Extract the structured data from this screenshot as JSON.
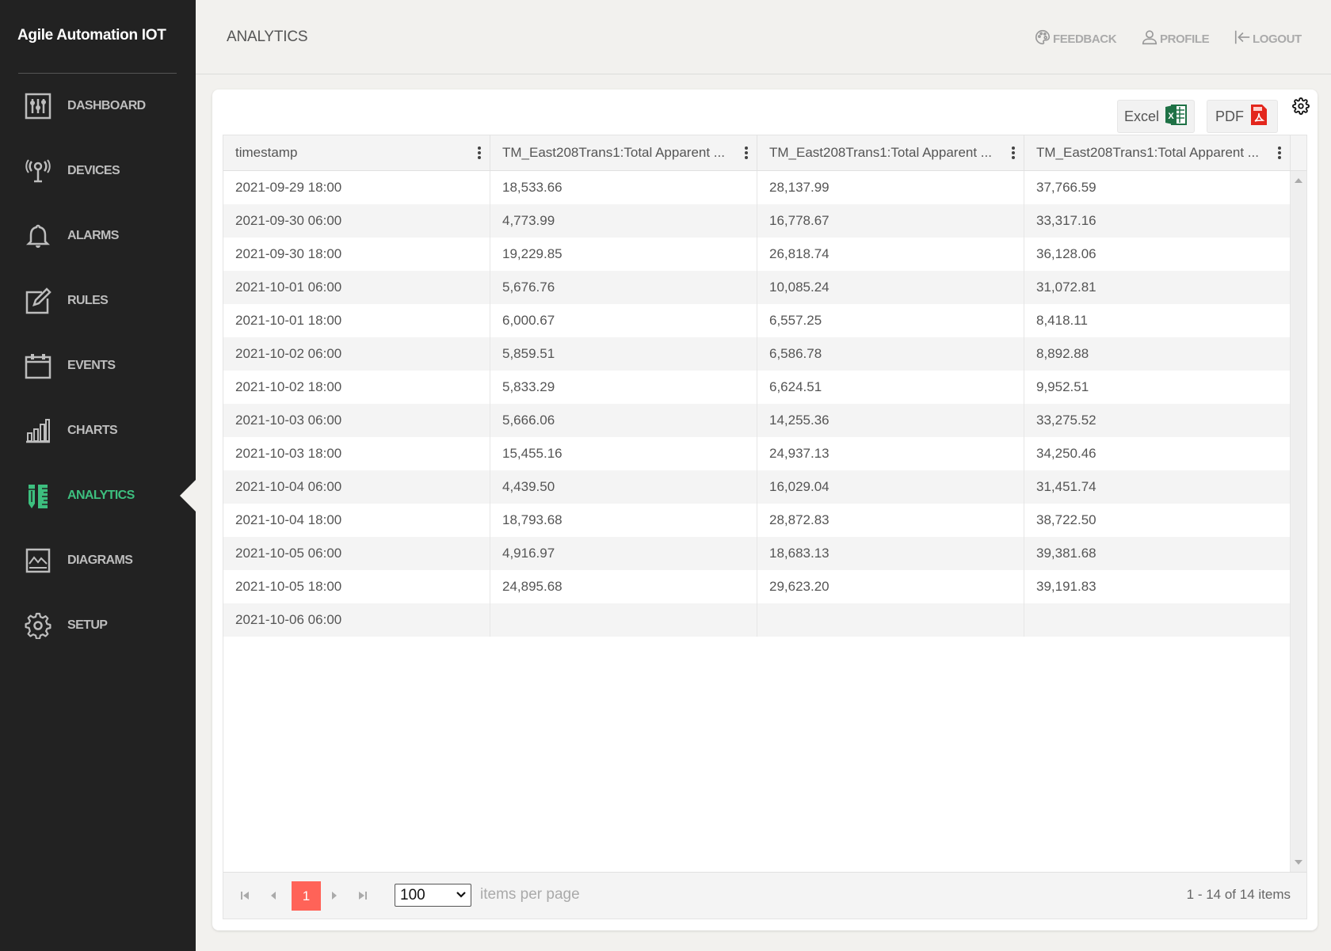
{
  "app": {
    "title": "Agile Automation IOT"
  },
  "sidebar": {
    "items": [
      {
        "label": "DASHBOARD",
        "icon": "dashboard-sliders-icon",
        "active": false
      },
      {
        "label": "DEVICES",
        "icon": "antenna-tower-icon",
        "active": false
      },
      {
        "label": "ALARMS",
        "icon": "bell-icon",
        "active": false
      },
      {
        "label": "RULES",
        "icon": "edit-pencil-icon",
        "active": false
      },
      {
        "label": "EVENTS",
        "icon": "calendar-icon",
        "active": false
      },
      {
        "label": "CHARTS",
        "icon": "bar-chart-icon",
        "active": false
      },
      {
        "label": "ANALYTICS",
        "icon": "pencil-ruler-icon",
        "active": true
      },
      {
        "label": "DIAGRAMS",
        "icon": "image-landscape-icon",
        "active": false
      },
      {
        "label": "SETUP",
        "icon": "gear-icon",
        "active": false
      }
    ],
    "active_color": "#3dbf7f"
  },
  "header": {
    "title": "ANALYTICS",
    "links": {
      "feedback": "FEEDBACK",
      "profile": "PROFILE",
      "logout": "LOGOUT"
    }
  },
  "toolbar": {
    "excel_label": "Excel",
    "pdf_label": "PDF"
  },
  "grid": {
    "columns": [
      "timestamp",
      "TM_East208Trans1:Total Apparent ...",
      "TM_East208Trans1:Total Apparent ...",
      "TM_East208Trans1:Total Apparent ..."
    ],
    "rows": [
      [
        "2021-09-29 18:00",
        "18,533.66",
        "28,137.99",
        "37,766.59"
      ],
      [
        "2021-09-30 06:00",
        "4,773.99",
        "16,778.67",
        "33,317.16"
      ],
      [
        "2021-09-30 18:00",
        "19,229.85",
        "26,818.74",
        "36,128.06"
      ],
      [
        "2021-10-01 06:00",
        "5,676.76",
        "10,085.24",
        "31,072.81"
      ],
      [
        "2021-10-01 18:00",
        "6,000.67",
        "6,557.25",
        "8,418.11"
      ],
      [
        "2021-10-02 06:00",
        "5,859.51",
        "6,586.78",
        "8,892.88"
      ],
      [
        "2021-10-02 18:00",
        "5,833.29",
        "6,624.51",
        "9,952.51"
      ],
      [
        "2021-10-03 06:00",
        "5,666.06",
        "14,255.36",
        "33,275.52"
      ],
      [
        "2021-10-03 18:00",
        "15,455.16",
        "24,937.13",
        "34,250.46"
      ],
      [
        "2021-10-04 06:00",
        "4,439.50",
        "16,029.04",
        "31,451.74"
      ],
      [
        "2021-10-04 18:00",
        "18,793.68",
        "28,872.83",
        "38,722.50"
      ],
      [
        "2021-10-05 06:00",
        "4,916.97",
        "18,683.13",
        "39,381.68"
      ],
      [
        "2021-10-05 18:00",
        "24,895.68",
        "29,623.20",
        "39,191.83"
      ],
      [
        "2021-10-06 06:00",
        "",
        "",
        ""
      ]
    ]
  },
  "pager": {
    "current_page": "1",
    "page_size": "100",
    "items_per_page_label": "items per page",
    "info": "1 - 14 of 14 items",
    "accent": "#ff6358"
  }
}
